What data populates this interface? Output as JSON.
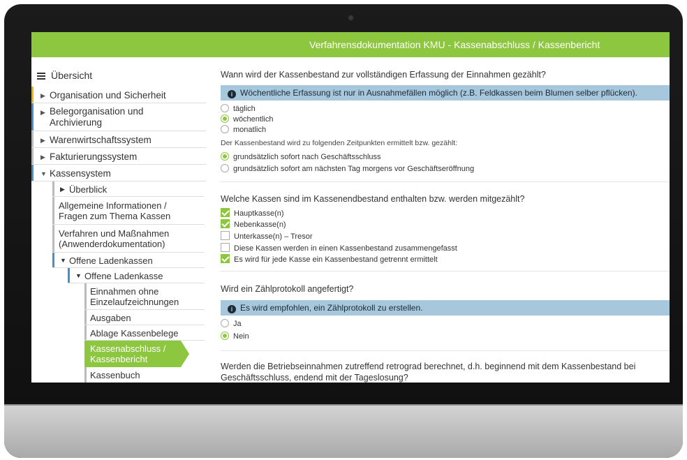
{
  "header": {
    "title": "Verfahrensdokumentation KMU - Kassenabschluss / Kassenbericht"
  },
  "sidebar": {
    "title": "Übersicht",
    "items": [
      {
        "label": "Organisation und Sicherheit",
        "accent": "#f2b705"
      },
      {
        "label": "Belegorganisation und Archivierung",
        "accent": "#4a90c8"
      },
      {
        "label": "Warenwirtschaftssystem",
        "accent": "#bbbbbb"
      },
      {
        "label": "Fakturierungssystem",
        "accent": "#bbbbbb"
      },
      {
        "label": "Kassensystem",
        "accent": "#4a90c8"
      }
    ],
    "kassen_children": {
      "ueberblick": "Überblick",
      "allgemein": "Allgemeine Informationen / Fragen zum Thema Kassen",
      "verfahren": "Verfahren und Maßnahmen (Anwenderdokumentation)",
      "offene_kassen": "Offene Ladenkassen",
      "offene_kasse": "Offene Ladenkasse",
      "einnahmen": "Einnahmen ohne Einzelaufzeichnungen",
      "ausgaben": "Ausgaben",
      "ablage": "Ablage Kassenbelege",
      "active": "Kassenabschluss / Kassenbericht",
      "kassenbuch": "Kassenbuch"
    }
  },
  "main": {
    "q1": {
      "question": "Wann wird der Kassenbestand zur vollständigen Erfassung der Einnahmen gezählt?",
      "info": "Wöchentliche Erfassung ist nur in Ausnahmefällen möglich (z.B. Feldkassen beim Blumen selber pflücken).",
      "options": [
        {
          "label": "täglich",
          "selected": false
        },
        {
          "label": "wöchentlich",
          "selected": true
        },
        {
          "label": "monatlich",
          "selected": false
        }
      ],
      "sub_question": "Der Kassenbestand wird zu folgenden Zeitpunkten ermittelt bzw. gezählt:",
      "sub_options": [
        {
          "label": "grundsätzlich sofort nach Geschäftsschluss",
          "selected": true
        },
        {
          "label": "grundsätzlich sofort am nächsten Tag morgens vor Geschäftseröffnung",
          "selected": false
        }
      ]
    },
    "q2": {
      "question": "Welche Kassen sind im Kassenendbestand enthalten bzw. werden mitgezählt?",
      "options": [
        {
          "label": "Hauptkasse(n)",
          "checked": true
        },
        {
          "label": "Nebenkasse(n)",
          "checked": true
        },
        {
          "label": "Unterkasse(n) – Tresor",
          "checked": false
        },
        {
          "label": "Diese Kassen werden in einen Kassenbestand zusammengefasst",
          "checked": false
        },
        {
          "label": "Es wird für jede Kasse ein Kassenbestand getrennt ermittelt",
          "checked": true
        }
      ]
    },
    "q3": {
      "question": "Wird ein Zählprotokoll angefertigt?",
      "info": "Es wird empfohlen, ein Zählprotokoll zu erstellen.",
      "options": [
        {
          "label": "Ja",
          "selected": false
        },
        {
          "label": "Nein",
          "selected": true
        }
      ]
    },
    "q4": {
      "question_line1": "Werden die Betriebseinnahmen zutreffend retrograd berechnet, d.h. beginnend mit dem Kassenbestand bei",
      "question_line2": "Geschäftsschluss, endend mit der Tageslosung?"
    }
  },
  "colors": {
    "accent_green": "#8dc63f",
    "info_blue": "#a7c7dc"
  }
}
